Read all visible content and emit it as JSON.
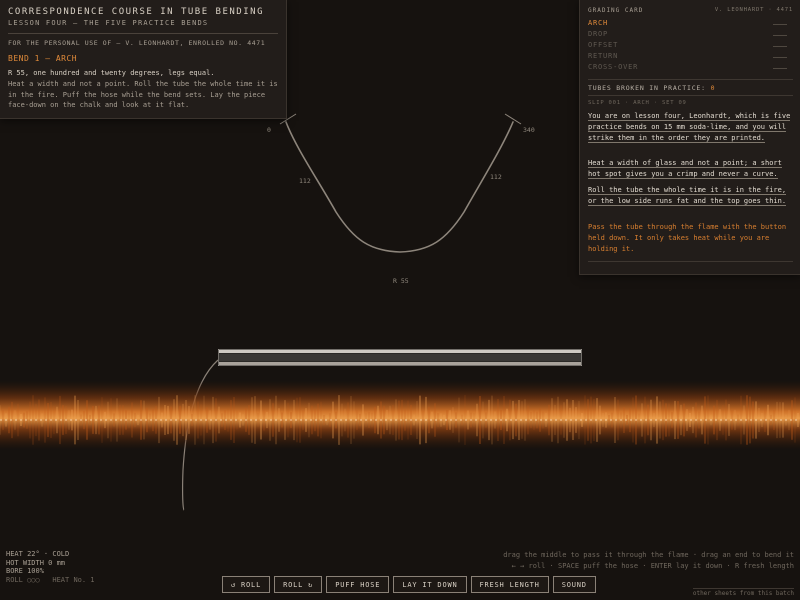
{
  "lesson": {
    "title": "CORRESPONDENCE COURSE IN TUBE BENDING",
    "subtitle": "LESSON FOUR — THE FIVE PRACTICE BENDS",
    "owner": "FOR THE PERSONAL USE OF — V. LEONHARDT, ENROLLED NO. 4471",
    "bend_title": "BEND 1 — ARCH",
    "spec": "R 55, one hundred and twenty degrees, legs equal.",
    "instructions": "Heat a width and not a point. Roll the tube the whole time it is in the fire. Puff the hose while the bend sets. Lay the piece face-down on the chalk and look at it flat."
  },
  "diagram": {
    "left_end": "0",
    "right_end": "340",
    "left_leg": "112",
    "right_leg": "112",
    "radius": "R 55"
  },
  "card": {
    "header": "GRADING CARD",
    "student": "V. LEONHARDT · 4471",
    "bends": [
      {
        "label": "ARCH",
        "active": true
      },
      {
        "label": "DROP",
        "active": false
      },
      {
        "label": "OFFSET",
        "active": false
      },
      {
        "label": "RETURN",
        "active": false
      },
      {
        "label": "CROSS-OVER",
        "active": false
      }
    ],
    "broken_label": "TUBES BROKEN IN PRACTICE:",
    "broken_count": "0",
    "slip": "SLIP 001 · ARCH · SET 09",
    "para1": "You are on lesson four, Leonhardt, which is five practice bends on 15 mm soda-lime, and you will strike them in the order they are printed.",
    "para2": "Heat a width of glass and not a point; a short hot spot gives you a crimp and never a curve.",
    "para3": "Roll the tube the whole time it is in the fire, or the low side runs fat and the top goes thin.",
    "para4": "Pass the tube through the flame with the button held down. It only takes heat while you are holding it.",
    "accent_color": "#e08a3a"
  },
  "status": {
    "heat": "HEAT 22°  ·  COLD",
    "hot_width": "HOT WIDTH 0 mm",
    "bore": "BORE 100%",
    "roll": "ROLL ○○○",
    "heat_no": "HEAT No. 1"
  },
  "help": {
    "line1": "drag the middle to pass it through the flame  ·  drag an end to bend it",
    "line2": "← → roll  ·  SPACE puff the hose  ·  ENTER lay it down  ·  R fresh length"
  },
  "buttons": {
    "roll_left": "↺ ROLL",
    "roll_right": "ROLL ↻",
    "puff": "PUFF HOSE",
    "lay": "LAY IT DOWN",
    "fresh": "FRESH LENGTH",
    "sound": "SOUND"
  },
  "other_sheets": "other sheets from this batch"
}
